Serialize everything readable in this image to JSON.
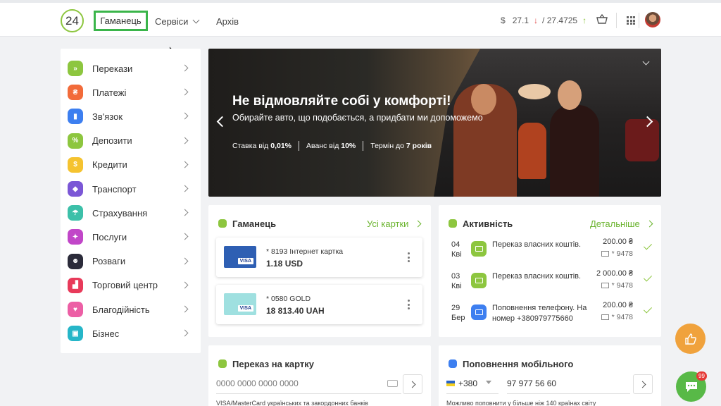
{
  "header": {
    "logo": "24",
    "nav": {
      "wallet": "Гаманець",
      "services": "Сервіси",
      "archive": "Архів"
    },
    "rate": {
      "currency": "$",
      "buy": "27.1",
      "buy_arrow": "↓",
      "sell": "/ 27.4725",
      "sell_arrow": "↑"
    }
  },
  "sidebar": {
    "items": [
      {
        "label": "Перекази",
        "icon": "transfer-icon",
        "color": "#8dc63f",
        "glyph": "»"
      },
      {
        "label": "Платежі",
        "icon": "payments-icon",
        "color": "#f26b3a",
        "glyph": "₴"
      },
      {
        "label": "Зв'язок",
        "icon": "signal-icon",
        "color": "#3d7ff0",
        "glyph": "▮"
      },
      {
        "label": "Депозити",
        "icon": "percent-icon",
        "color": "#8dc63f",
        "glyph": "%"
      },
      {
        "label": "Кредити",
        "icon": "money-bag-icon",
        "color": "#f5c330",
        "glyph": "$"
      },
      {
        "label": "Транспорт",
        "icon": "transport-icon",
        "color": "#7b57d6",
        "glyph": "◆"
      },
      {
        "label": "Страхування",
        "icon": "umbrella-icon",
        "color": "#3cc0a9",
        "glyph": "☂"
      },
      {
        "label": "Послуги",
        "icon": "puzzle-icon",
        "color": "#c146c8",
        "glyph": "✦"
      },
      {
        "label": "Розваги",
        "icon": "smile-icon",
        "color": "#2b2b3a",
        "glyph": "☻"
      },
      {
        "label": "Торговий центр",
        "icon": "shopping-cart-icon",
        "color": "#e83a5a",
        "glyph": "▟"
      },
      {
        "label": "Благодійність",
        "icon": "heart-icon",
        "color": "#ec5fa5",
        "glyph": "♥"
      },
      {
        "label": "Бізнес",
        "icon": "briefcase-icon",
        "color": "#26b6c8",
        "glyph": "▣"
      }
    ]
  },
  "banner": {
    "title": "Не відмовляйте собі у комфорті!",
    "subtitle": "Обирайте авто, що подобається, а придбати ми допоможемо",
    "terms": [
      {
        "text": "Ставка від ",
        "bold": "0,01%"
      },
      {
        "text": "Аванс від ",
        "bold": "10%"
      },
      {
        "text": "Термін до ",
        "bold": "7 років"
      }
    ]
  },
  "wallet": {
    "title": "Гаманець",
    "link": "Усі картки",
    "cards": [
      {
        "number": "* 8193  Інтернет картка",
        "balance": "1.18 USD",
        "badge": "VISA",
        "color": "#2e5fb3"
      },
      {
        "number": "* 0580  GOLD",
        "balance": "18 813.40 UAH",
        "badge": "VISA",
        "color": "#9fe0e0"
      }
    ]
  },
  "activity": {
    "title": "Активність",
    "link": "Детальніше",
    "items": [
      {
        "day": "04",
        "month": "Кві",
        "desc": "Переказ власних коштів.",
        "amount": "200.00 ₴",
        "card": "* 9478",
        "color": "#8dc63f"
      },
      {
        "day": "03",
        "month": "Кві",
        "desc": "Переказ власних коштів.",
        "amount": "2 000.00 ₴",
        "card": "* 9478",
        "color": "#8dc63f"
      },
      {
        "day": "29",
        "month": "Бер",
        "desc": "Поповнення телефону. На номер +380979775660",
        "amount": "200.00 ₴",
        "card": "* 9478",
        "color": "#3d7ff0"
      }
    ]
  },
  "transfer": {
    "title": "Переказ на картку",
    "placeholder": "0000 0000 0000 0000",
    "hint": "VISA/MasterCard українських та закордонних банків"
  },
  "mobile": {
    "title": "Поповнення мобільного",
    "code": "+380",
    "number": "97 977 56 60",
    "hint": "Можливо поповнити у більше ніж 140 країнах світу"
  },
  "chat_badge": "99"
}
